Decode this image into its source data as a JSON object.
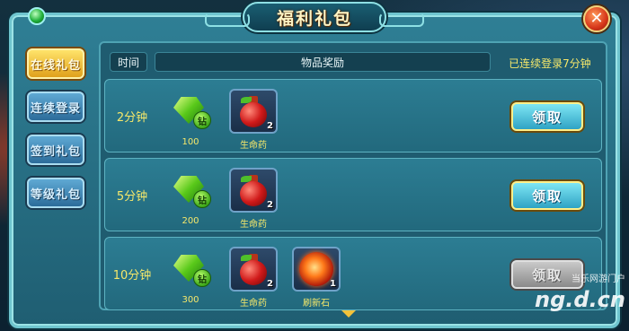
{
  "dialog": {
    "title": "福利礼包",
    "close_label": "✕"
  },
  "tabs": [
    {
      "label": "在线礼包",
      "active": true
    },
    {
      "label": "连续登录",
      "active": false
    },
    {
      "label": "签到礼包",
      "active": false
    },
    {
      "label": "等级礼包",
      "active": false
    }
  ],
  "header": {
    "time_label": "时间",
    "reward_label": "物品奖励",
    "login_status": "已连续登录7分钟"
  },
  "diamond_badge": "钻",
  "rows": [
    {
      "time": "2分钟",
      "items": [
        {
          "icon": "diamond-icon",
          "label": "100"
        },
        {
          "icon": "potion-icon",
          "label": "生命药",
          "qty": "2"
        }
      ],
      "claim_label": "领取",
      "claim_enabled": true
    },
    {
      "time": "5分钟",
      "items": [
        {
          "icon": "diamond-icon",
          "label": "200"
        },
        {
          "icon": "potion-icon",
          "label": "生命药",
          "qty": "2"
        }
      ],
      "claim_label": "领取",
      "claim_enabled": true
    },
    {
      "time": "10分钟",
      "items": [
        {
          "icon": "diamond-icon",
          "label": "300"
        },
        {
          "icon": "potion-icon",
          "label": "生命药",
          "qty": "2"
        },
        {
          "icon": "refresh-stone-icon",
          "label": "刷新石",
          "qty": "1"
        }
      ],
      "claim_label": "领取",
      "claim_enabled": false
    }
  ],
  "watermark": {
    "text": "当乐网游门户",
    "domain": "ng.d.cn"
  }
}
